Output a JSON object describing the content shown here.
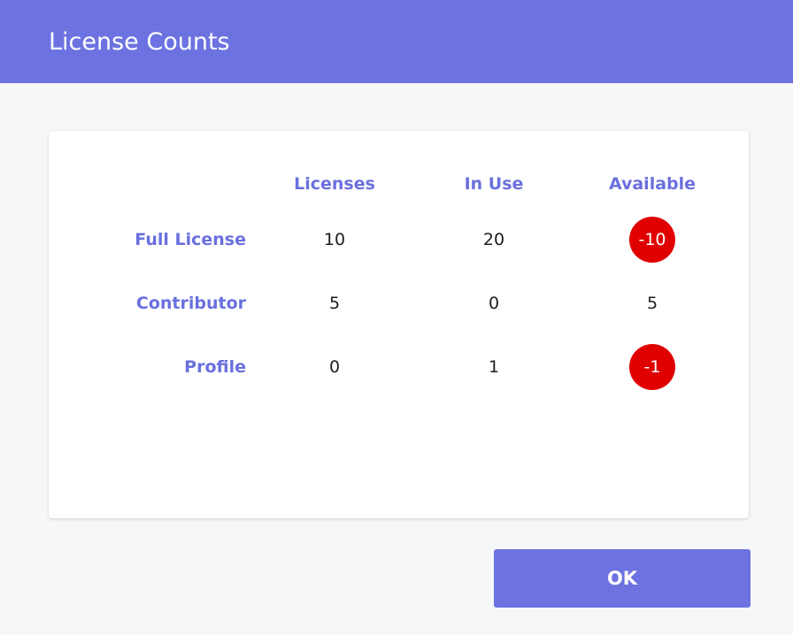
{
  "dialog": {
    "title": "License Counts",
    "ok_label": "OK"
  },
  "table": {
    "headers": [
      "Licenses",
      "In Use",
      "Available"
    ],
    "rows": [
      {
        "label": "Full License",
        "licenses": "10",
        "in_use": "20",
        "available": "-10",
        "available_negative": true
      },
      {
        "label": "Contributor",
        "licenses": "5",
        "in_use": "0",
        "available": "5",
        "available_negative": false
      },
      {
        "label": "Profile",
        "licenses": "0",
        "in_use": "1",
        "available": "-1",
        "available_negative": true
      }
    ]
  },
  "colors": {
    "accent": "#6c72e0",
    "negative_badge": "#e00000"
  }
}
